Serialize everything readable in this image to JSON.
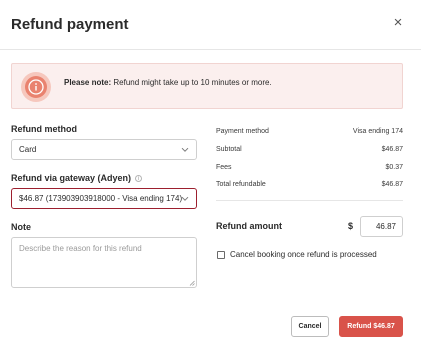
{
  "dialog": {
    "title": "Refund payment",
    "close_label": "×"
  },
  "notice": {
    "strong": "Please note:",
    "text": " Refund might take up to 10 minutes or more."
  },
  "form": {
    "refund_method_label": "Refund method",
    "refund_method_value": "Card",
    "gateway_label": "Refund via gateway (Adyen)",
    "gateway_info_icon": "i",
    "gateway_value": "$46.87 (173903903918000 - Visa ending  174)",
    "note_label": "Note",
    "note_placeholder": "Describe the reason for this refund"
  },
  "summary": {
    "rows": [
      {
        "label": "Payment method",
        "value": "Visa ending  174"
      },
      {
        "label": "Subtotal",
        "value": "$46.87"
      },
      {
        "label": "Fees",
        "value": "$0.37"
      },
      {
        "label": "Total refundable",
        "value": "$46.87"
      }
    ],
    "refund_amount_label": "Refund amount",
    "currency_symbol": "$",
    "refund_amount_value": "46.87",
    "cancel_booking_label": "Cancel booking once refund is processed"
  },
  "actions": {
    "cancel_label": "Cancel",
    "refund_label": "Refund $46.87"
  },
  "colors": {
    "accent": "#d9534a",
    "focus_border": "#9c1f2e",
    "notice_bg": "#fbefee"
  }
}
